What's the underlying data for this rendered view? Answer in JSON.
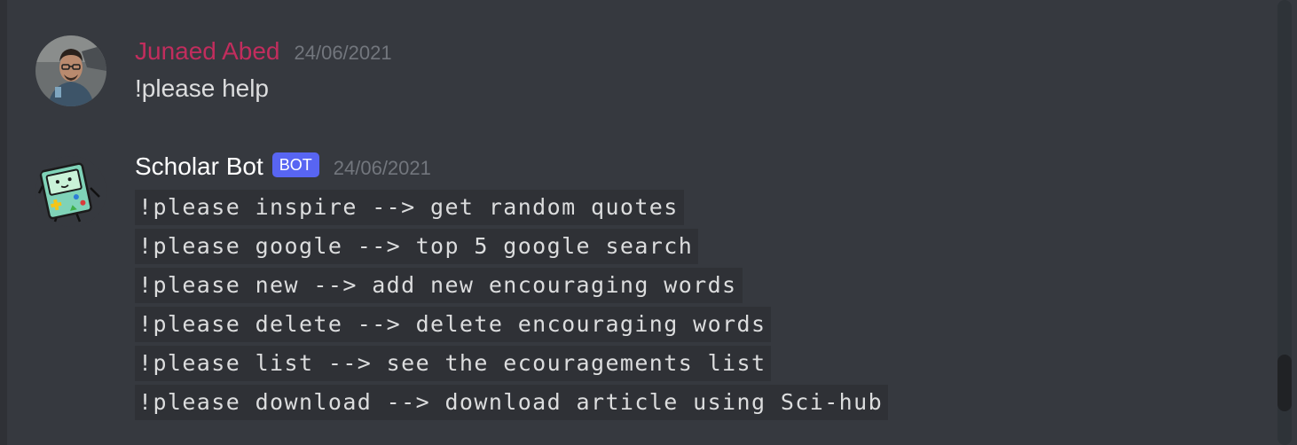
{
  "messages": [
    {
      "author": "Junaed Abed",
      "timestamp": "24/06/2021",
      "text": "!please help",
      "author_color": "#c12d5d",
      "avatar_icon": "user-photo-avatar"
    },
    {
      "author": "Scholar Bot",
      "bot_tag": "BOT",
      "timestamp": "24/06/2021",
      "avatar_icon": "bmo-robot-avatar",
      "code_lines": [
        "!please inspire --> get random quotes",
        "!please google --> top 5 google search",
        "!please new --> add new encouraging words",
        "!please delete --> delete encouraging words",
        "!please list --> see the ecouragements list",
        "!please download --> download article using Sci-hub"
      ]
    }
  ],
  "colors": {
    "background": "#36393f",
    "bot_tag": "#5865f2",
    "timestamp": "#72767d",
    "code_background": "#2f3136"
  }
}
